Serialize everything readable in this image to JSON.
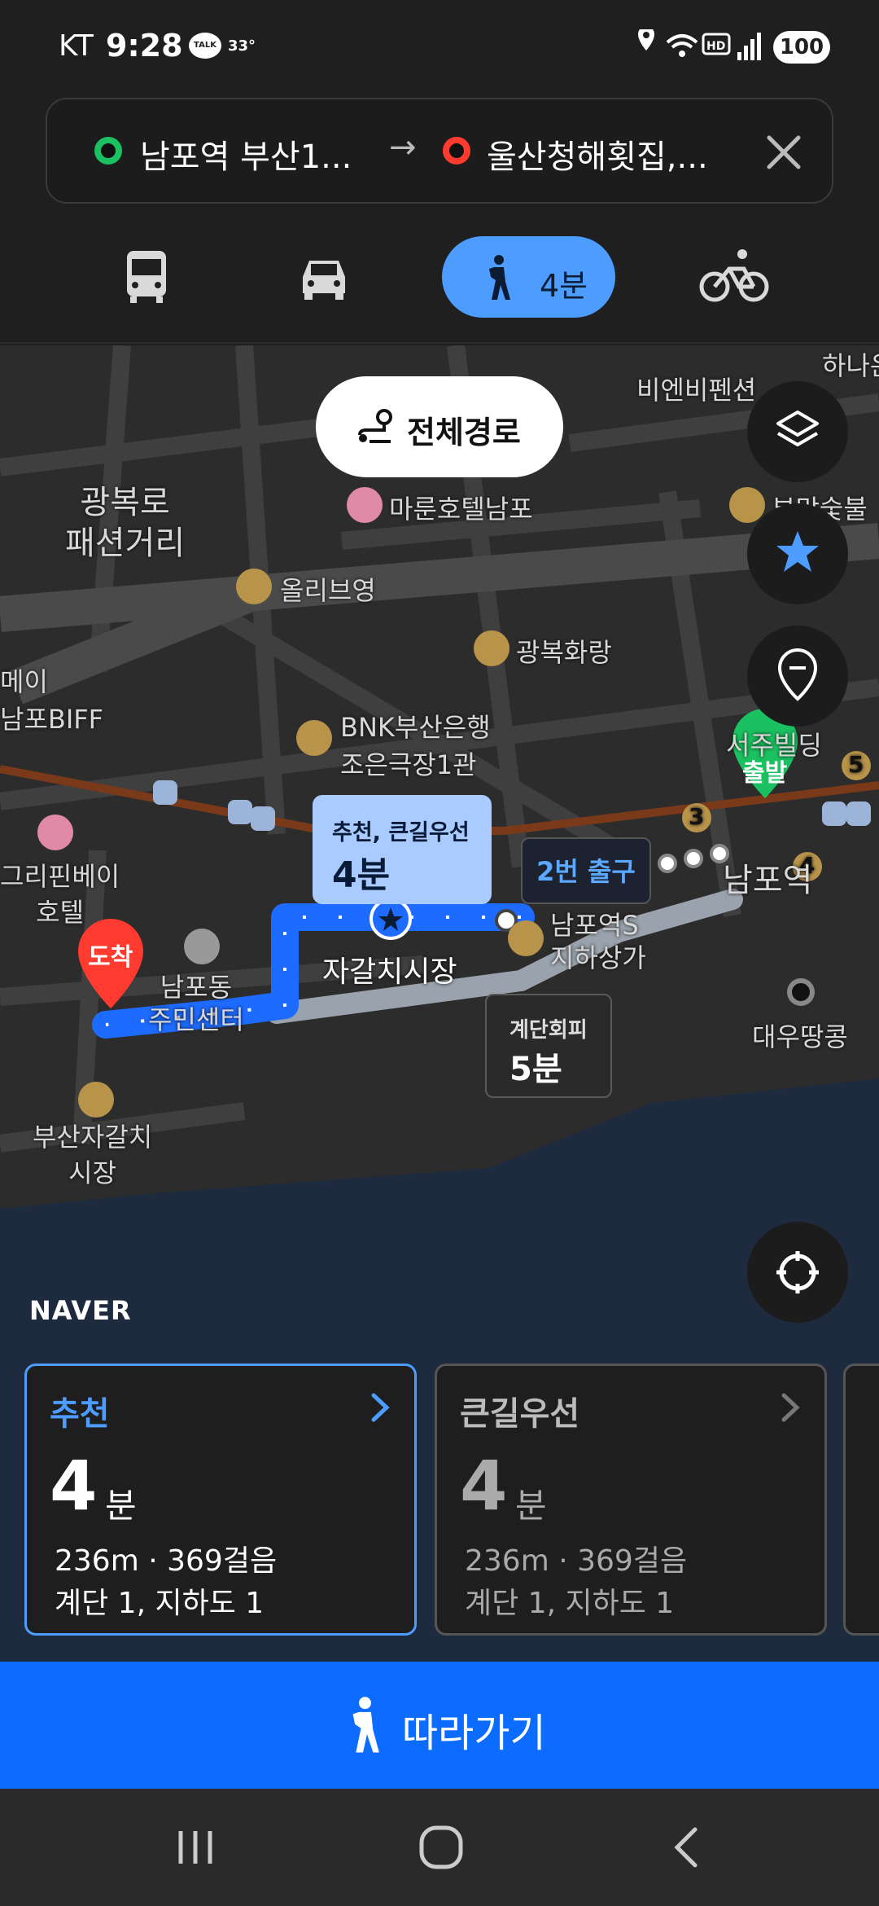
{
  "status": {
    "carrier": "KT",
    "time": "9:28",
    "talk_badge": "TALK",
    "temp_label": "33°",
    "battery": "100"
  },
  "route": {
    "from": "남포역 부산1...",
    "to": "울산청해횟집,...",
    "arrow": "→"
  },
  "modes": {
    "walk_label": "4분"
  },
  "map": {
    "full_route_label": "전체경로",
    "labels": {
      "gwangbok": "광복로\n패션거리",
      "marun": "마룬호텔남포",
      "olive": "올리브영",
      "gwangbok_hwarang": "광복화랑",
      "bnk": "BNK부산은행\n조은극장1관",
      "biff": "메이\n남포BIFF",
      "bienbi": "비엔비펜션",
      "seoju": "서주빌딩",
      "nampo_station": "남포역",
      "jagalchi": "자갈치시장",
      "nampo_underground": "남포역S\n지하상가",
      "nampodong_center": "남포동\n주민센터",
      "griffin": "그리핀베이\n호텔",
      "busan_jagalchi": "부산자갈치\n시장",
      "daewoo": "대우땅콩",
      "hana": "하나은",
      "bumasuk": "부막숯불"
    },
    "start_pin": "출발",
    "end_pin": "도착",
    "tip_route": {
      "title": "추천, 큰길우선",
      "time": "4분"
    },
    "tip_exit": "2번 출구",
    "tip_stairs": {
      "title": "계단회피",
      "time": "5분"
    },
    "exit_badges": [
      "3",
      "4",
      "5"
    ],
    "brand": "NAVER"
  },
  "cards": [
    {
      "name": "추천",
      "minutes": "4",
      "unit": "분",
      "line1": "236m · 369걸음",
      "line2": "계단 1, 지하도 1"
    },
    {
      "name": "큰길우선",
      "minutes": "4",
      "unit": "분",
      "line1": "236m · 369걸음",
      "line2": "계단 1, 지하도 1"
    }
  ],
  "follow_label": "따라가기",
  "colors": {
    "accent": "#4c9dff",
    "follow": "#0b6cff",
    "start_green": "#1bc160",
    "end_red": "#ff3b2f",
    "route_blue": "#1e6bff"
  },
  "icons": [
    "bus-icon",
    "car-icon",
    "walk-icon",
    "bike-icon",
    "close-icon",
    "layers-icon",
    "star-icon",
    "location-pin-icon",
    "crosshair-icon",
    "route-icon"
  ]
}
